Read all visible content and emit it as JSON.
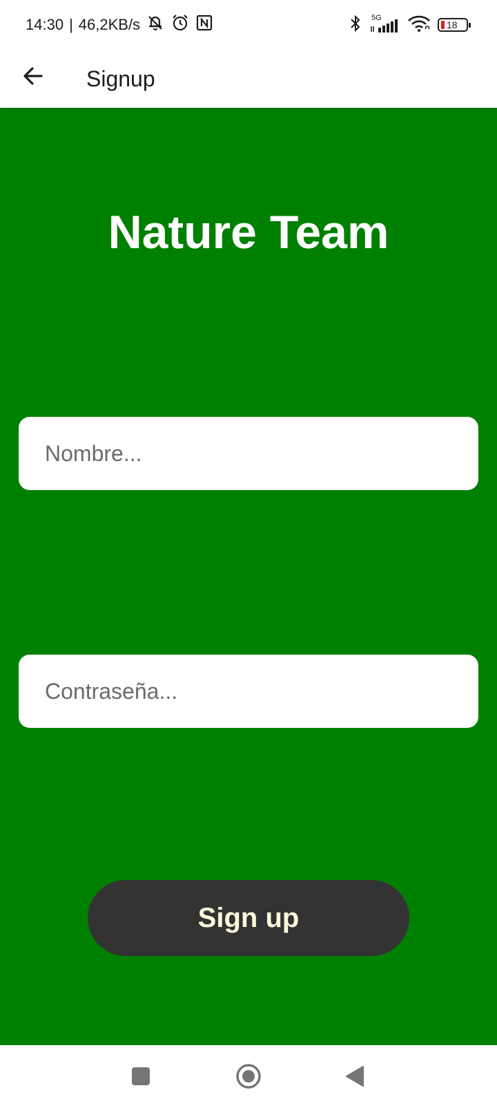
{
  "status_bar": {
    "time": "14:30",
    "separator": "|",
    "network_speed": "46,2KB/s",
    "signal_type": "5G",
    "battery_level": "18",
    "battery_color": "#e0201b"
  },
  "app_bar": {
    "title": "Signup",
    "back_icon": "arrow-left-icon"
  },
  "main": {
    "background_color": "#008000",
    "brand_title": "Nature Team",
    "name_field": {
      "placeholder": "Nombre...",
      "value": ""
    },
    "password_field": {
      "placeholder": "Contraseña...",
      "value": ""
    },
    "signup_button": {
      "label": "Sign up",
      "background": "#333333",
      "text_color": "#fff8dc"
    }
  },
  "nav_bar": {
    "recent_icon": "square-icon",
    "home_icon": "circle-home-icon",
    "back_icon": "triangle-back-icon"
  }
}
